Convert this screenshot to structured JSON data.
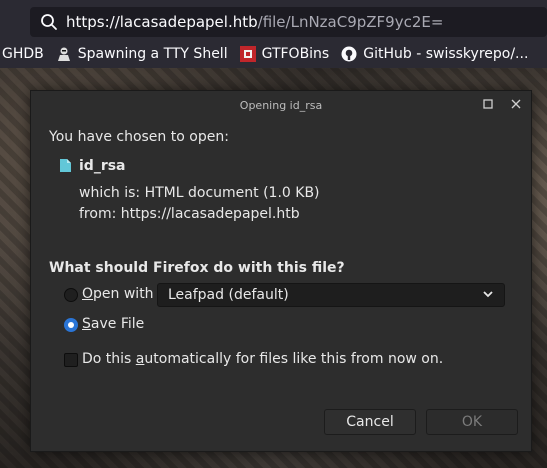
{
  "browser": {
    "url_host": "https://lacasadepapel.htb",
    "url_path": "/file/LnNzaC9pZF9yc2E="
  },
  "bookmarks": [
    {
      "label": "GHDB",
      "icon": "none"
    },
    {
      "label": "Spawning a TTY Shell",
      "icon": "hacker-icon"
    },
    {
      "label": "GTFOBins",
      "icon": "gtfobins-icon"
    },
    {
      "label": "GitHub - swisskyrepo/...",
      "icon": "github-icon"
    }
  ],
  "dialog": {
    "title": "Opening id_rsa",
    "prompt": "You have chosen to open:",
    "filename": "id_rsa",
    "which_is_label": "which is:",
    "which_is_value": "HTML document (1.0 KB)",
    "from_label": "from:",
    "from_value": "https://lacasadepapel.htb",
    "question": "What should Firefox do with this file?",
    "open_with_prefix": "O",
    "open_with_rest": "pen with",
    "open_with_app": "Leafpad (default)",
    "save_file_prefix": "S",
    "save_file_rest": "ave File",
    "auto_before": "Do this ",
    "auto_underlined": "a",
    "auto_after": "utomatically for files like this from now on.",
    "cancel_label": "Cancel",
    "ok_label": "OK",
    "selected_option": "save_file",
    "auto_checked": false
  },
  "colors": {
    "accent": "#2a75d6",
    "dialog_bg": "#2d2d2d"
  }
}
